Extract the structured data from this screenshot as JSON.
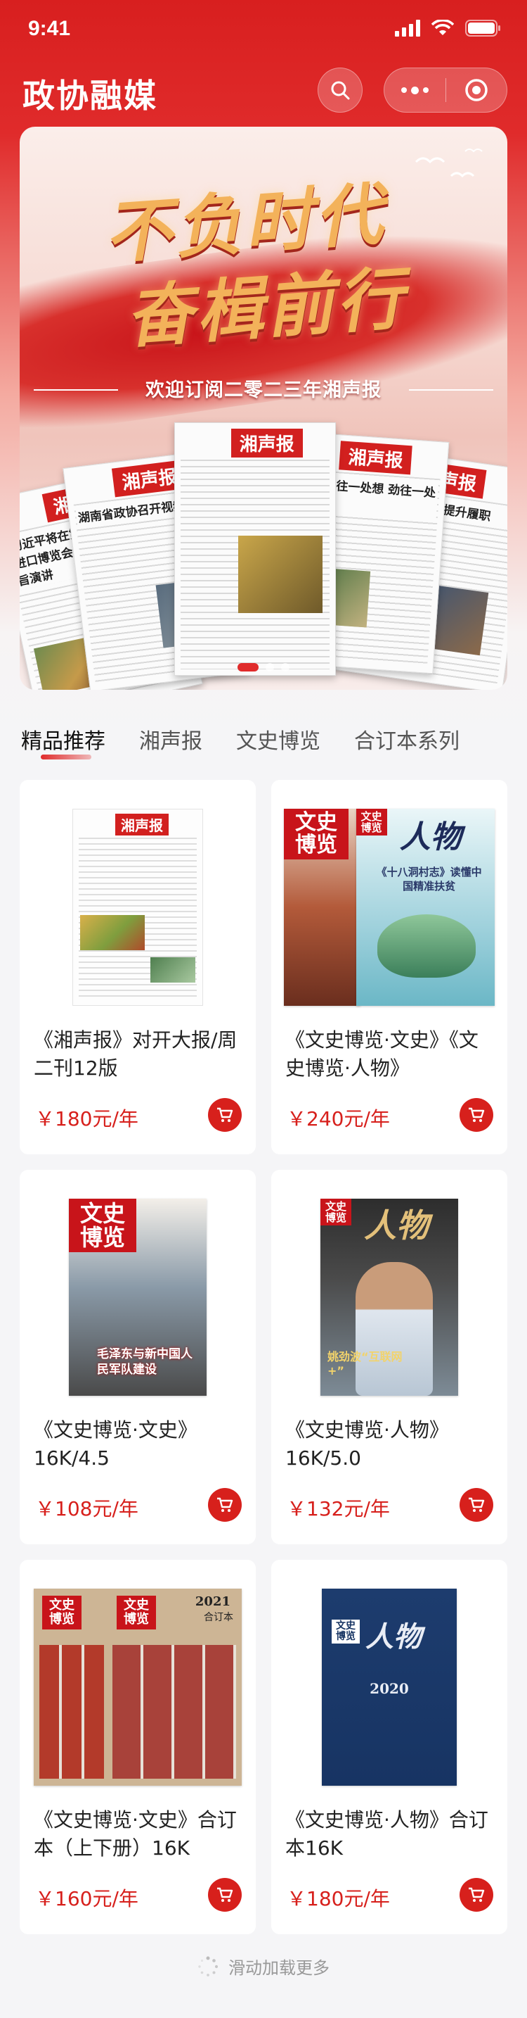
{
  "status_bar": {
    "time": "9:41"
  },
  "header": {
    "title": "政协融媒"
  },
  "banner": {
    "slogan_line1": "不负时代",
    "slogan_line2": "奋楫前行",
    "subtitle": "欢迎订阅二零二三年湘声报",
    "masthead": "湘声报",
    "paper_headlines": [
      "习近平将在第五届中国国际进口博览会开幕式上发表主旨演讲",
      "形成心往一处想 劲往一处使",
      "湖南省政协召开视频会",
      "深化红色教育 提升履职"
    ],
    "slide_count": 3,
    "active_slide": 0
  },
  "tabs": [
    {
      "label": "精品推荐",
      "active": true
    },
    {
      "label": "湘声报",
      "active": false
    },
    {
      "label": "文史博览",
      "active": false
    },
    {
      "label": "合订本系列",
      "active": false
    }
  ],
  "products": [
    {
      "title": "《湘声报》对开大报/周二刊12版",
      "price": "￥180元/年",
      "cover": "newspaper",
      "cover_text": "湘声报"
    },
    {
      "title": "《文史博览·文史》《文史博览·人物》",
      "price": "￥240元/年",
      "cover": "pair",
      "cover_text": "文史博览",
      "cover_text2": "人物",
      "cover_caption": "《十八洞村志》读懂中国精准扶贫"
    },
    {
      "title": "《文史博览·文史》16K/4.5",
      "price": "￥108元/年",
      "cover": "wenshi",
      "cover_text": "文史博览",
      "cover_caption": "毛泽东与新中国人民军队建设"
    },
    {
      "title": "《文史博览·人物》16K/5.0",
      "price": "￥132元/年",
      "cover": "renwu",
      "cover_text": "文史博览",
      "cover_text2": "人物",
      "cover_caption": "姚劲波“互联网+”"
    },
    {
      "title": "《文史博览·文史》合订本（上下册）16K",
      "price": "￥160元/年",
      "cover": "bound",
      "cover_text": "文史博览",
      "cover_year": "2021",
      "cover_sub": "合订本"
    },
    {
      "title": "《文史博览·人物》合订本16K",
      "price": "￥180元/年",
      "cover": "bluebound",
      "cover_text": "文史博览",
      "cover_text2": "人物",
      "cover_year": "2020"
    }
  ],
  "footer": {
    "loading_text": "滑动加载更多"
  },
  "colors": {
    "accent": "#d7201c",
    "header_red": "#d81f1f"
  }
}
